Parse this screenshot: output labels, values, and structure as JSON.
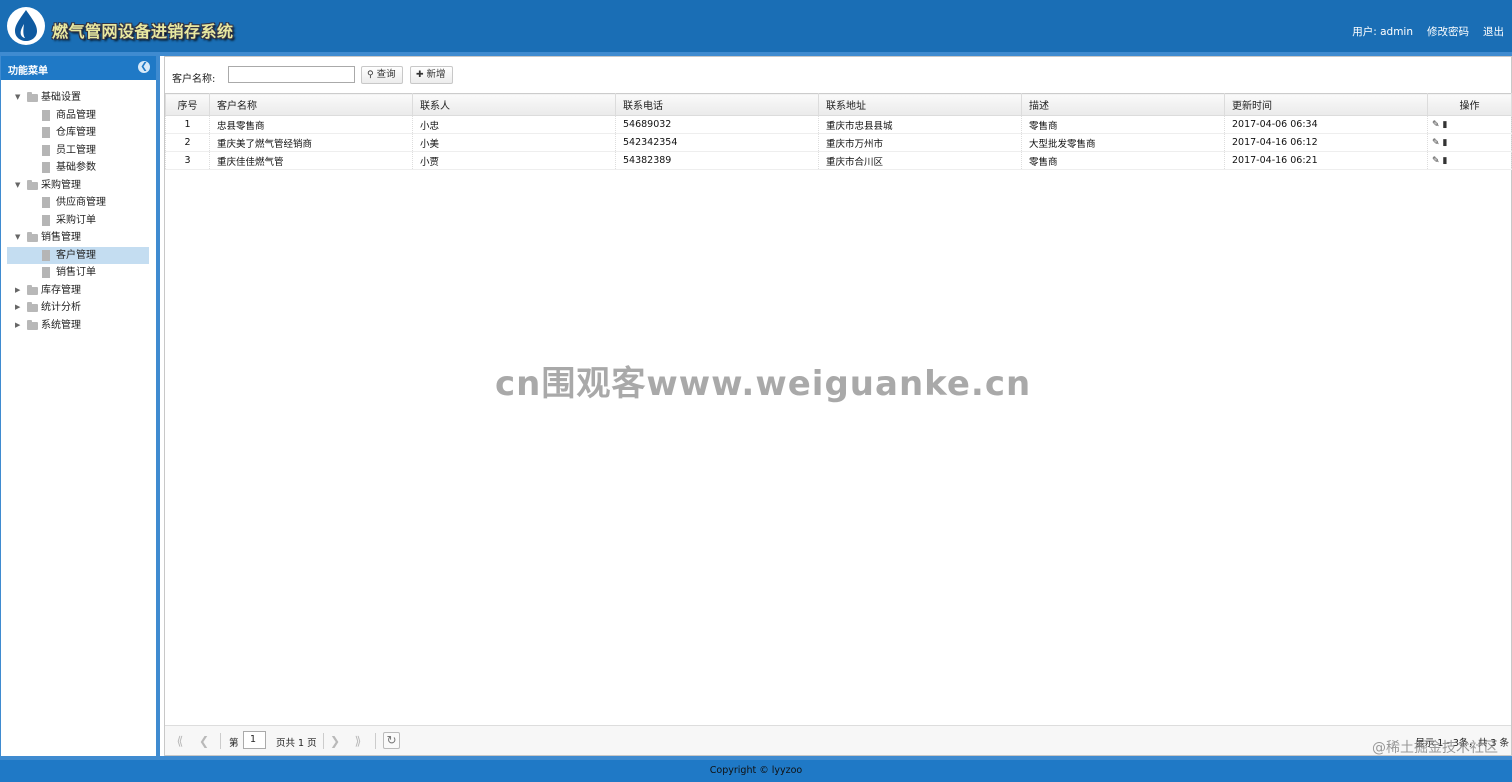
{
  "header": {
    "app_title": "燃气管网设备进销存系统",
    "user_label": "用户: admin",
    "change_password": "修改密码",
    "logout": "退出",
    "brand_color": "#1a6eb5"
  },
  "sidebar": {
    "title": "功能菜单",
    "groups": [
      {
        "label": "基础设置",
        "expanded": true,
        "items": [
          {
            "label": "商品管理"
          },
          {
            "label": "仓库管理"
          },
          {
            "label": "员工管理"
          },
          {
            "label": "基础参数"
          }
        ]
      },
      {
        "label": "采购管理",
        "expanded": true,
        "items": [
          {
            "label": "供应商管理"
          },
          {
            "label": "采购订单"
          }
        ]
      },
      {
        "label": "销售管理",
        "expanded": true,
        "items": [
          {
            "label": "客户管理",
            "selected": true
          },
          {
            "label": "销售订单"
          }
        ]
      },
      {
        "label": "库存管理",
        "expanded": false,
        "items": []
      },
      {
        "label": "统计分析",
        "expanded": false,
        "items": []
      },
      {
        "label": "系统管理",
        "expanded": false,
        "items": []
      }
    ]
  },
  "toolbar": {
    "customer_name_label": "客户名称:",
    "customer_name_value": "",
    "search_label": "查询",
    "add_label": "新增"
  },
  "table": {
    "columns": [
      "序号",
      "客户名称",
      "联系人",
      "联系电话",
      "联系地址",
      "描述",
      "更新时间",
      "操作"
    ],
    "rows": [
      [
        "1",
        "忠县零售商",
        "小忠",
        "54689032",
        "重庆市忠县县城",
        "零售商",
        "2017-04-06 06:34"
      ],
      [
        "2",
        "重庆美了燃气管经销商",
        "小美",
        "542342354",
        "重庆市万州市",
        "大型批发零售商",
        "2017-04-16 06:12"
      ],
      [
        "3",
        "重庆佳佳燃气管",
        "小贾",
        "54382389",
        "重庆市合川区",
        "零售商",
        "2017-04-16 06:21"
      ]
    ]
  },
  "pager": {
    "page_prefix": "第",
    "page_value": "1",
    "page_suffix": "页共 1 页",
    "summary": "显示 1 - 3条，共 3 条"
  },
  "footer": {
    "copyright": "Copyright © lyyzoo"
  },
  "watermark": {
    "text": "cn围观客www.weiguanke.cn",
    "corner": "@稀土掘金技术社区"
  }
}
